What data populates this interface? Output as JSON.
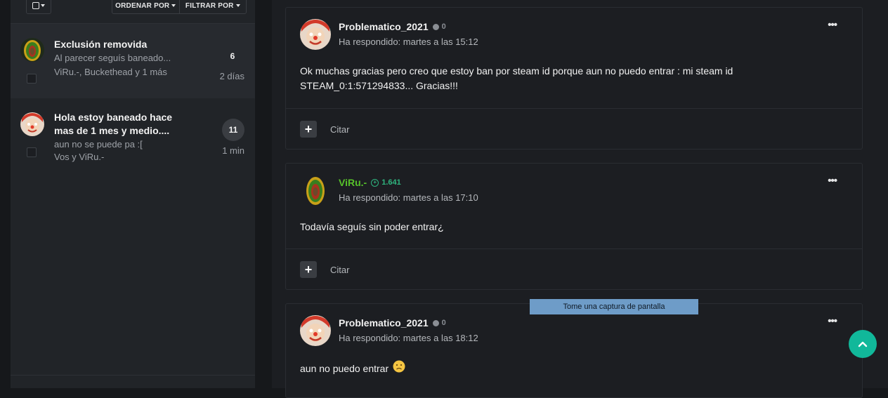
{
  "toolbar": {
    "sort_label": "ORDENAR POR",
    "filter_label": "FILTRAR POR"
  },
  "threads": [
    {
      "title": "Exclusión removida",
      "snippet": "Al parecer seguís baneado...",
      "participants": "ViRu.-, Buckethead y 1 más",
      "count": "6",
      "time": "2 días",
      "avatar": "rasta-lion-avatar",
      "active": true
    },
    {
      "title": "Hola estoy baneado hace mas de 1 mes y medio....",
      "snippet": "aun no se puede pa :[",
      "participants": "Vos y ViRu.-",
      "count": "11",
      "time": "1 min",
      "avatar": "clown-avatar",
      "active": false
    }
  ],
  "posts": [
    {
      "author": "Problematico_2021",
      "reputation": "0",
      "meta": "Ha respondido: martes a las 15:12",
      "body": "Ok muchas gracias pero creo que estoy ban por steam id porque aun no puedo entrar : mi steam id STEAM_0:1:571294833... Gracias!!!",
      "quote_label": "Citar",
      "menu": "•••"
    },
    {
      "author": "ViRu.-",
      "reputation": "1.641",
      "meta": "Ha respondido: martes a las 17:10",
      "body": "Todavía seguís sin poder entrar¿",
      "quote_label": "Citar",
      "menu": "•••"
    },
    {
      "author": "Problematico_2021",
      "reputation": "0",
      "meta": "Ha respondido: martes a las 18:12",
      "body": "aun no puedo entrar",
      "menu": "•••"
    }
  ],
  "screenshot_hint": "Tome una captura de pantalla",
  "colors": {
    "accent": "#11b89a",
    "moderator_name": "#57c22a",
    "reputation_positive": "#2fb57f"
  }
}
